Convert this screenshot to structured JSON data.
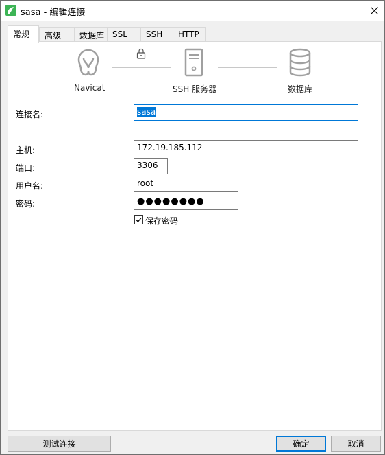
{
  "window": {
    "title": "sasa - 编辑连接",
    "close_icon": "close-icon"
  },
  "tabs": [
    {
      "label": "常规",
      "active": true
    },
    {
      "label": "高级",
      "active": false
    },
    {
      "label": "数据库",
      "active": false
    },
    {
      "label": "SSL",
      "active": false
    },
    {
      "label": "SSH",
      "active": false
    },
    {
      "label": "HTTP",
      "active": false
    }
  ],
  "diagram": {
    "client_label": "Navicat",
    "server_label": "SSH 服务器",
    "database_label": "数据库"
  },
  "form": {
    "connection_name_label": "连接名:",
    "connection_name_value": "sasa",
    "host_label": "主机:",
    "host_value": "172.19.185.112",
    "port_label": "端口:",
    "port_value": "3306",
    "username_label": "用户名:",
    "username_value": "root",
    "password_label": "密码:",
    "password_value": "●●●●●●●●",
    "save_password_label": "保存密码",
    "save_password_checked": true
  },
  "buttons": {
    "test_label": "测试连接",
    "ok_label": "确定",
    "cancel_label": "取消"
  },
  "colors": {
    "accent": "#0078d7",
    "app_icon": "#3cb455"
  }
}
